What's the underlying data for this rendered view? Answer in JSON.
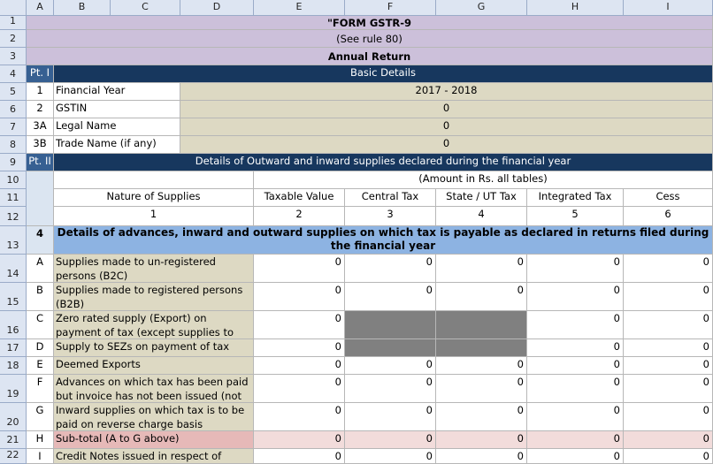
{
  "columns": [
    "A",
    "B",
    "C",
    "D",
    "E",
    "F",
    "G",
    "H",
    "I"
  ],
  "rows": [
    "1",
    "2",
    "3",
    "4",
    "5",
    "6",
    "7",
    "8",
    "9",
    "10",
    "11",
    "12",
    "13",
    "14",
    "15",
    "16",
    "17",
    "18",
    "19",
    "20",
    "21",
    "22"
  ],
  "form": {
    "title": "\"FORM GSTR-9",
    "subtitle": "(See rule 80)",
    "return_type": "Annual Return"
  },
  "part1": {
    "label": "Pt. I",
    "heading": "Basic Details",
    "rows": [
      {
        "no": "1",
        "label": "Financial Year",
        "value": "2017 - 2018"
      },
      {
        "no": "2",
        "label": "GSTIN",
        "value": "0"
      },
      {
        "no": "3A",
        "label": "Legal Name",
        "value": "0"
      },
      {
        "no": "3B",
        "label": "Trade Name (if any)",
        "value": "0"
      }
    ]
  },
  "part2": {
    "label": "Pt. II",
    "heading": "Details of Outward and inward supplies declared during the financial year",
    "amount_note": "(Amount in Rs. all tables)",
    "col_headers": [
      "Nature of Supplies",
      "Taxable Value",
      "Central Tax",
      "State / UT Tax",
      "Integrated Tax",
      "Cess"
    ],
    "col_numbers": [
      "1",
      "2",
      "3",
      "4",
      "5",
      "6"
    ]
  },
  "section4": {
    "no": "4",
    "heading": "Details of advances, inward and outward supplies on which tax is payable as declared in returns filed during the financial year",
    "rows": [
      {
        "code": "A",
        "label": "Supplies made to un-registered persons (B2C)",
        "values": [
          "0",
          "0",
          "0",
          "0",
          "0"
        ]
      },
      {
        "code": "B",
        "label": "Supplies made to registered persons (B2B)",
        "values": [
          "0",
          "0",
          "0",
          "0",
          "0"
        ]
      },
      {
        "code": "C",
        "label": "Zero rated supply (Export) on payment of tax (except supplies to SEZs)",
        "values": [
          "0",
          "",
          "",
          "0",
          "0"
        ]
      },
      {
        "code": "D",
        "label": "Supply to SEZs on payment of tax",
        "values": [
          "0",
          "",
          "",
          "0",
          "0"
        ]
      },
      {
        "code": "E",
        "label": "Deemed Exports",
        "values": [
          "0",
          "0",
          "0",
          "0",
          "0"
        ]
      },
      {
        "code": "F",
        "label": "Advances on which tax has been paid but invoice has not been issued (not",
        "values": [
          "0",
          "0",
          "0",
          "0",
          "0"
        ]
      },
      {
        "code": "G",
        "label": "Inward supplies on which tax is to be paid on reverse charge basis",
        "values": [
          "0",
          "0",
          "0",
          "0",
          "0"
        ]
      },
      {
        "code": "H",
        "label": "Sub-total (A to G above)",
        "values": [
          "0",
          "0",
          "0",
          "0",
          "0"
        ]
      },
      {
        "code": "I",
        "label": "Credit Notes issued in respect of",
        "values": [
          "0",
          "0",
          "0",
          "0",
          "0"
        ]
      }
    ]
  },
  "colors": {
    "title_band": "#ccc0da",
    "part_band": "#17375e",
    "section_band": "#8db3e2",
    "label_cells": "#ddd9c3",
    "disabled_cells": "#808080",
    "subtotal_row": "#f2dcdb"
  }
}
